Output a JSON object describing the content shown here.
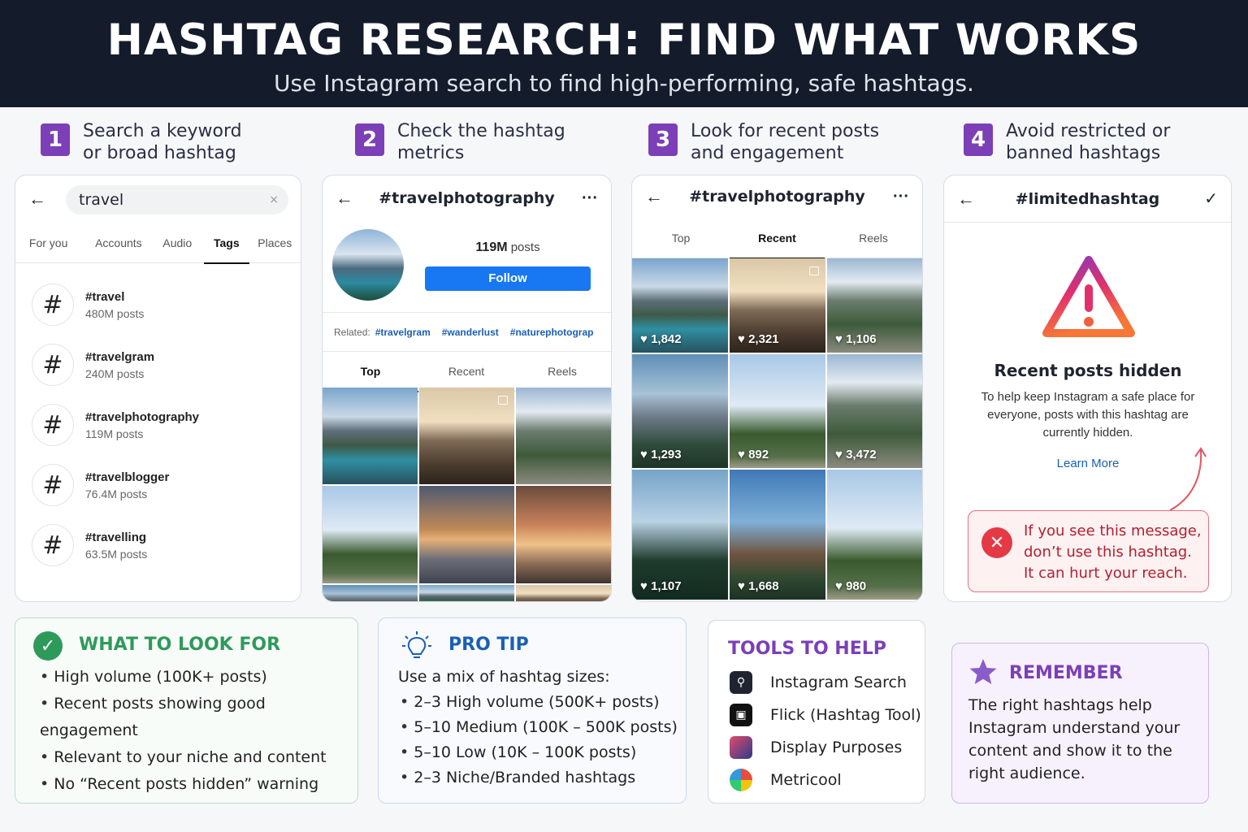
{
  "banner": {
    "title": "HASHTAG RESEARCH: FIND WHAT WORKS",
    "subtitle": "Use Instagram search to find high-performing, safe hashtags."
  },
  "steps": [
    {
      "num": "1",
      "text": "Search a keyword or broad hashtag"
    },
    {
      "num": "2",
      "text": "Check the hashtag metrics"
    },
    {
      "num": "3",
      "text": "Look for recent posts and engagement"
    },
    {
      "num": "4",
      "text": "Avoid restricted or banned hashtags"
    }
  ],
  "search": {
    "query": "travel",
    "clear": "×",
    "tabs": [
      "For you",
      "Accounts",
      "Audio",
      "Tags",
      "Places"
    ],
    "active_tab": "Tags",
    "results": [
      {
        "name": "#travel",
        "count": "480M posts"
      },
      {
        "name": "#travelgram",
        "count": "240M posts"
      },
      {
        "name": "#travelphotography",
        "count": "119M posts"
      },
      {
        "name": "#travelblogger",
        "count": "76.4M posts"
      },
      {
        "name": "#travelling",
        "count": "63.5M posts"
      }
    ]
  },
  "metrics": {
    "title": "#travelphotography",
    "posts_num": "119M",
    "posts_word": "posts",
    "follow": "Follow",
    "related_label": "Related:",
    "related": [
      "#travelgram",
      "#wanderlust",
      "#naturephotograp"
    ],
    "tabs": [
      "Top",
      "Recent",
      "Reels"
    ]
  },
  "recent": {
    "title": "#travelphotography",
    "tabs": [
      "Top",
      "Recent",
      "Reels"
    ],
    "likes": [
      "1,842",
      "2,321",
      "1,106",
      "1,293",
      "892",
      "3,472",
      "1,107",
      "1,668",
      "980"
    ]
  },
  "restricted": {
    "title": "#limitedhashtag",
    "heading": "Recent posts hidden",
    "desc": "To help keep Instagram a safe place for everyone, posts with this hashtag are currently hidden.",
    "link": "Learn More",
    "alert": "If you see this message, don’t use this hashtag. It can hurt your reach."
  },
  "lookfor": {
    "title": "WHAT TO LOOK FOR",
    "items": [
      "High volume (100K+ posts)",
      "Recent posts showing good engagement",
      "Relevant to your niche and content",
      "No “Recent posts hidden” warning"
    ]
  },
  "protip": {
    "title": "PRO TIP",
    "intro": "Use a mix of hashtag sizes:",
    "items": [
      "2–3 High volume (500K+ posts)",
      "5–10 Medium (100K – 500K posts)",
      "5–10 Low (10K – 100K posts)",
      "2–3 Niche/Branded hashtags"
    ]
  },
  "tools": {
    "title": "TOOLS TO HELP",
    "items": [
      "Instagram Search",
      "Flick (Hashtag Tool)",
      "Display Purposes",
      "Metricool"
    ]
  },
  "remember": {
    "title": "REMEMBER",
    "text": "The right hashtags help Instagram understand your content and show it to the right audience."
  },
  "colors": {
    "banner": "#141b2b",
    "step_badge": "#7c3fb7",
    "follow": "#1877f2",
    "green": "#2e9a5a",
    "blue": "#1a5fb4",
    "purple": "#7c3fb7",
    "alert_red": "#e53945"
  }
}
